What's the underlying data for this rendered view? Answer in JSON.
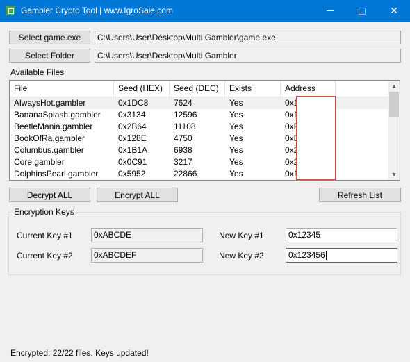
{
  "window": {
    "title": "Gambler Crypto Tool | www.IgroSale.com",
    "close_glyph": "✕"
  },
  "paths": {
    "select_game_label": "Select game.exe",
    "game_path": "C:\\Users\\User\\Desktop\\Multi Gambler\\game.exe",
    "select_folder_label": "Select Folder",
    "folder_path": "C:\\Users\\User\\Desktop\\Multi Gambler"
  },
  "files": {
    "section_label": "Available Files",
    "columns": [
      "File",
      "Seed (HEX)",
      "Seed (DEC)",
      "Exists",
      "Address"
    ],
    "rows": [
      {
        "file": "AlwaysHot.gambler",
        "hex": "0x1DC8",
        "dec": "7624",
        "exists": "Yes",
        "address": "0x1"
      },
      {
        "file": "BananaSplash.gambler",
        "hex": "0x3134",
        "dec": "12596",
        "exists": "Yes",
        "address": "0x1"
      },
      {
        "file": "BeetleMania.gambler",
        "hex": "0x2B64",
        "dec": "11108",
        "exists": "Yes",
        "address": "0xF"
      },
      {
        "file": "BookOfRa.gambler",
        "hex": "0x128E",
        "dec": "4750",
        "exists": "Yes",
        "address": "0xD"
      },
      {
        "file": "Columbus.gambler",
        "hex": "0x1B1A",
        "dec": "6938",
        "exists": "Yes",
        "address": "0x2"
      },
      {
        "file": "Core.gambler",
        "hex": "0x0C91",
        "dec": "3217",
        "exists": "Yes",
        "address": "0x2"
      },
      {
        "file": "DolphinsPearl.gambler",
        "hex": "0x5952",
        "dec": "22866",
        "exists": "Yes",
        "address": "0x1"
      }
    ],
    "scroll_up_glyph": "▲",
    "scroll_down_glyph": "▼"
  },
  "actions": {
    "decrypt_all": "Decrypt ALL",
    "encrypt_all": "Encrypt ALL",
    "refresh_list": "Refresh List"
  },
  "keys": {
    "group_title": "Encryption Keys",
    "current_key_1_label": "Current Key #1",
    "current_key_1_value": "0xABCDE",
    "current_key_2_label": "Current Key #2",
    "current_key_2_value": "0xABCDEF",
    "new_key_1_label": "New Key #1",
    "new_key_1_value": "0x12345",
    "new_key_2_label": "New Key #2",
    "new_key_2_value": "0x123456"
  },
  "status": "Encrypted: 22/22 files. Keys updated!"
}
